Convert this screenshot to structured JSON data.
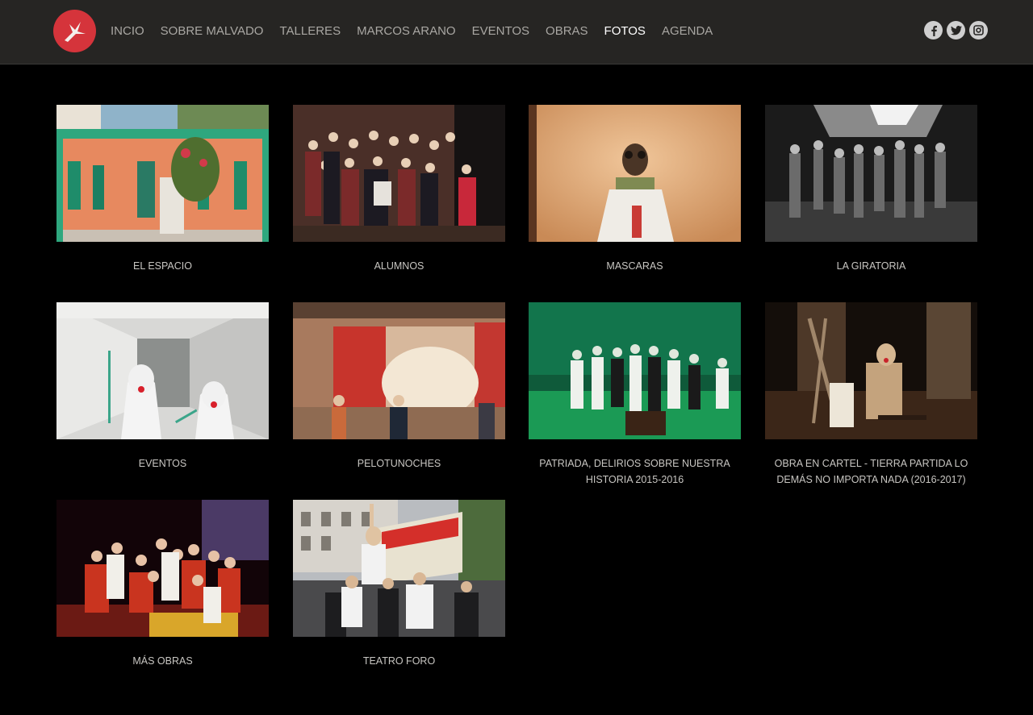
{
  "nav": {
    "items": [
      {
        "label": "INCIO",
        "active": false
      },
      {
        "label": "SOBRE MALVADO",
        "active": false
      },
      {
        "label": "TALLERES",
        "active": false
      },
      {
        "label": "MARCOS ARANO",
        "active": false
      },
      {
        "label": "EVENTOS",
        "active": false
      },
      {
        "label": "OBRAS",
        "active": false
      },
      {
        "label": "FOTOS",
        "active": true
      },
      {
        "label": "AGENDA",
        "active": false
      }
    ]
  },
  "social": [
    "facebook-icon",
    "twitter-icon",
    "instagram-icon"
  ],
  "colors": {
    "header_bg": "#262523",
    "accent": "#d5343b",
    "nav_text": "#a9a7a3",
    "page_bg": "#000000"
  },
  "gallery": [
    {
      "caption": "EL ESPACIO"
    },
    {
      "caption": "ALUMNOS"
    },
    {
      "caption": "MASCARAS"
    },
    {
      "caption": "LA GIRATORIA"
    },
    {
      "caption": "EVENTOS"
    },
    {
      "caption": "PELOTUNOCHES"
    },
    {
      "caption": "PATRIADA, DELIRIOS SOBRE NUESTRA HISTORIA 2015-2016"
    },
    {
      "caption": "OBRA EN CARTEL - TIERRA PARTIDA LO DEMÁS NO IMPORTA NADA (2016-2017)"
    },
    {
      "caption": "MÁS OBRAS"
    },
    {
      "caption": "TEATRO FORO"
    }
  ]
}
